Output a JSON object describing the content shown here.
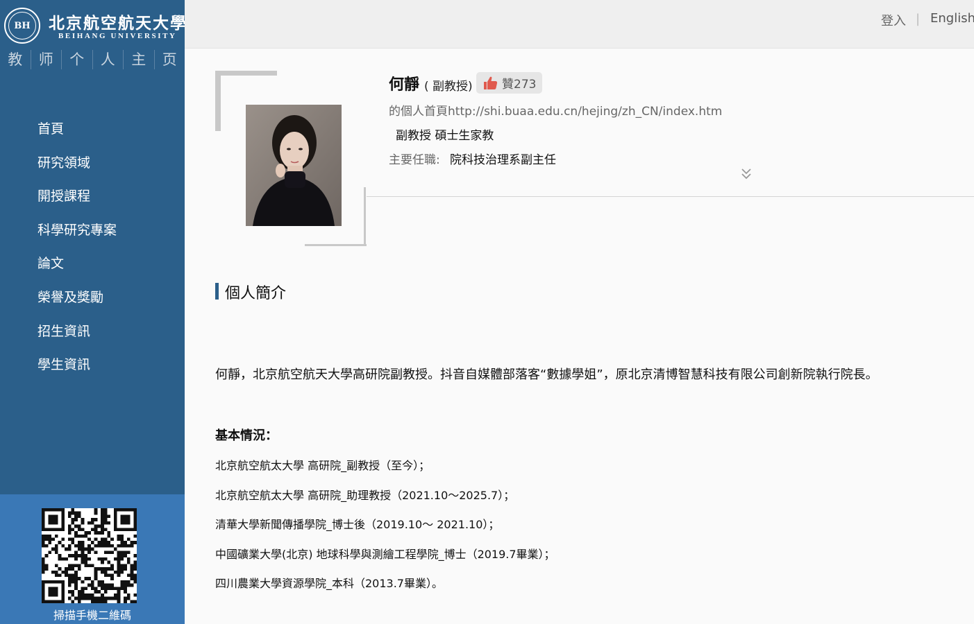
{
  "sidebar": {
    "university_cn": "北京航空航天大學",
    "university_en": "BEIHANG UNIVERSITY",
    "homepage_chars": [
      "教",
      "师",
      "个",
      "人",
      "主",
      "页"
    ],
    "nav": [
      {
        "label": "首頁"
      },
      {
        "label": "研究領域"
      },
      {
        "label": "開授課程"
      },
      {
        "label": "科學研究專案"
      },
      {
        "label": "論文"
      },
      {
        "label": "榮譽及獎勵"
      },
      {
        "label": "招生資訊"
      },
      {
        "label": "學生資訊"
      }
    ],
    "qr_caption": "掃描手機二維碼"
  },
  "topbar": {
    "login": "登入",
    "divider": "|",
    "english": "English"
  },
  "profile": {
    "name": "何靜",
    "title_paren": "( 副教授)",
    "like_label": "贊273",
    "homepage_url": "的個人首頁http://shi.buaa.edu.cn/hejing/zh_CN/index.htm",
    "ranks": "副教授 碩士生家教",
    "position_label": "主要任職:",
    "position_value": "院科技治理系副主任"
  },
  "section": {
    "title": "個人簡介",
    "intro": "何靜，北京航空航天大學高研院副教授。抖音自媒體部落客“數據學姐”，原北京清博智慧科技有限公司創新院執行院長。",
    "basic_heading": "基本情況：",
    "career": [
      "北京航空航太大學 高研院_副教授（至今）；",
      "北京航空航太大學 高研院_助理教授（2021.10～2025.7）；",
      "清華大學新聞傳播學院_博士後（2019.10～ 2021.10）；",
      "中國礦業大學(北京) 地球科學與測繪工程學院_博士（2019.7畢業）；",
      "四川農業大學資源學院_本科（2013.7畢業）。"
    ]
  },
  "colors": {
    "sidebar": "#2b5f8a",
    "qr_panel": "#3a78b6",
    "like_icon": "#e05a4e"
  },
  "icons": {
    "seal": "university-seal-icon",
    "like": "thumbs-up-icon",
    "expand": "double-chevron-down-icon"
  }
}
